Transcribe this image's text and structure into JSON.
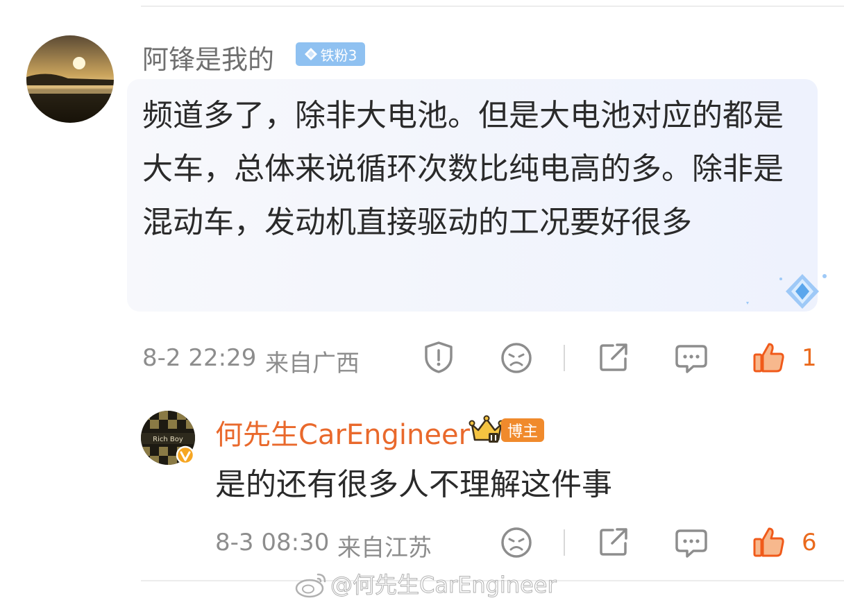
{
  "comment": {
    "username": "阿锋是我的",
    "fan_badge": "铁粉3",
    "text": "频道多了，除非大电池。但是大电池对应的都是大车，总体来说循环次数比纯电高的多。除非是混动车，发动机直接驱动的工况要好很多",
    "time": "8-2 22:29",
    "location": "来自广西",
    "like_count": "1"
  },
  "reply": {
    "username": "何先生CarEngineer",
    "avatar_text": "Rich Boy",
    "role_badge": "博主",
    "text": "是的还有很多人不理解这件事",
    "time": "8-3 08:30",
    "location": "来自江苏",
    "like_count": "6"
  },
  "watermark": "@何先生CarEngineer",
  "icons": {
    "report": "report-icon",
    "dislike": "sad-face-icon",
    "share": "share-icon",
    "comment": "comment-icon",
    "like": "thumbs-up-icon"
  },
  "colors": {
    "accent": "#e9692c",
    "like": "#f05a1a",
    "muted": "#8d8d8d"
  }
}
